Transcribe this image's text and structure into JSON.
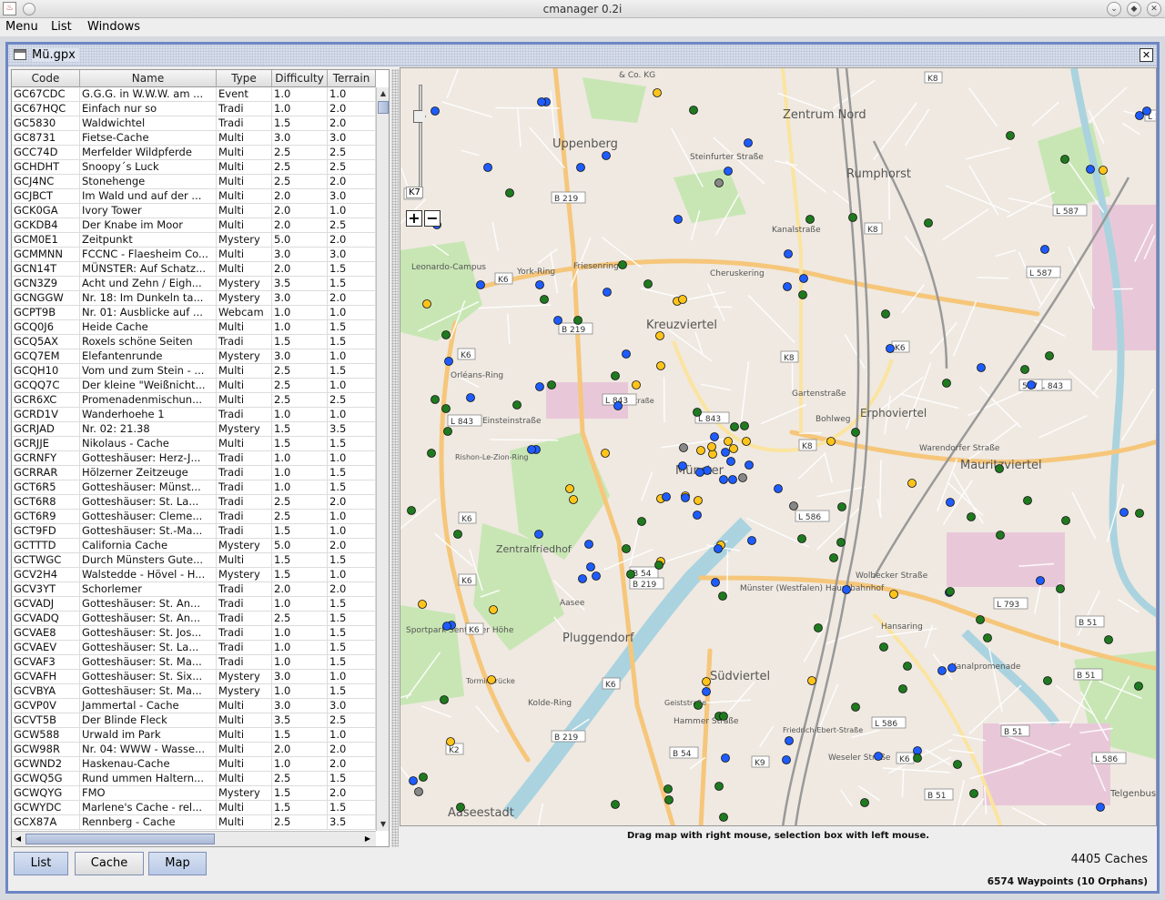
{
  "window": {
    "title": "cmanager 0.2i"
  },
  "menubar": {
    "items": [
      "Menu",
      "List",
      "Windows"
    ]
  },
  "frame": {
    "title": "Mü.gpx"
  },
  "table": {
    "columns": [
      "Code",
      "Name",
      "Type",
      "Difficulty",
      "Terrain"
    ],
    "rows": [
      [
        "GC67CDC",
        "G.G.G. in W.W.W. am ...",
        "Event",
        "1.0",
        "1.0"
      ],
      [
        "GC67HQC",
        "Einfach nur so",
        "Tradi",
        "1.0",
        "2.0"
      ],
      [
        "GC5830",
        "Waldwichtel",
        "Tradi",
        "1.5",
        "2.0"
      ],
      [
        "GC8731",
        "Fietse-Cache",
        "Multi",
        "3.0",
        "3.0"
      ],
      [
        "GCC74D",
        "Merfelder Wildpferde",
        "Multi",
        "2.5",
        "2.5"
      ],
      [
        "GCHDHT",
        "Snoopy´s Luck",
        "Multi",
        "2.5",
        "2.5"
      ],
      [
        "GCJ4NC",
        "Stonehenge",
        "Multi",
        "2.5",
        "2.0"
      ],
      [
        "GCJBCT",
        "Im Wald und auf der ...",
        "Multi",
        "2.0",
        "3.0"
      ],
      [
        "GCK0GA",
        "Ivory Tower",
        "Multi",
        "2.0",
        "1.0"
      ],
      [
        "GCKDB4",
        "Der Knabe im Moor",
        "Multi",
        "2.0",
        "2.5"
      ],
      [
        "GCM0E1",
        "Zeitpunkt",
        "Mystery",
        "5.0",
        "2.0"
      ],
      [
        "GCMMNN",
        "FCCNC - Flaesheim Co...",
        "Multi",
        "3.0",
        "3.0"
      ],
      [
        "GCN14T",
        "MÜNSTER: Auf Schatz...",
        "Multi",
        "2.0",
        "1.5"
      ],
      [
        "GCN3Z9",
        "Acht und Zehn / Eigh...",
        "Mystery",
        "3.5",
        "1.5"
      ],
      [
        "GCNGGW",
        "Nr. 18: Im Dunkeln ta...",
        "Mystery",
        "3.0",
        "2.0"
      ],
      [
        "GCPT9B",
        "Nr. 01: Ausblicke auf ...",
        "Webcam",
        "1.0",
        "1.0"
      ],
      [
        "GCQ0J6",
        "Heide Cache",
        "Multi",
        "1.0",
        "1.5"
      ],
      [
        "GCQ5AX",
        "Roxels schöne Seiten",
        "Tradi",
        "1.5",
        "1.5"
      ],
      [
        "GCQ7EM",
        "Elefantenrunde",
        "Mystery",
        "3.0",
        "1.0"
      ],
      [
        "GCQH10",
        "Vom und zum Stein - ...",
        "Multi",
        "2.5",
        "1.5"
      ],
      [
        "GCQQ7C",
        "Der kleine \"Weißnicht...",
        "Multi",
        "2.5",
        "1.0"
      ],
      [
        "GCR6XC",
        "Promenadenmischun...",
        "Multi",
        "2.5",
        "2.5"
      ],
      [
        "GCRD1V",
        "Wanderhoehe 1",
        "Tradi",
        "1.0",
        "1.0"
      ],
      [
        "GCRJAD",
        "Nr. 02: 21.38",
        "Mystery",
        "1.5",
        "3.5"
      ],
      [
        "GCRJJE",
        "Nikolaus - Cache",
        "Multi",
        "1.5",
        "1.5"
      ],
      [
        "GCRNFY",
        "Gotteshäuser: Herz-J...",
        "Tradi",
        "1.0",
        "1.0"
      ],
      [
        "GCRRAR",
        "Hölzerner Zeitzeuge",
        "Tradi",
        "1.0",
        "1.5"
      ],
      [
        "GCT6R5",
        "Gotteshäuser: Münst...",
        "Tradi",
        "1.0",
        "1.5"
      ],
      [
        "GCT6R8",
        "Gotteshäuser: St. La...",
        "Tradi",
        "2.5",
        "2.0"
      ],
      [
        "GCT6R9",
        "Gotteshäuser: Cleme...",
        "Tradi",
        "2.5",
        "1.0"
      ],
      [
        "GCT9FD",
        "Gotteshäuser: St.-Ma...",
        "Tradi",
        "1.5",
        "1.0"
      ],
      [
        "GCTTTD",
        "California Cache",
        "Mystery",
        "5.0",
        "2.0"
      ],
      [
        "GCTWGC",
        "Durch Münsters Gute...",
        "Multi",
        "1.5",
        "1.5"
      ],
      [
        "GCV2H4",
        "Walstedde - Hövel - H...",
        "Mystery",
        "1.5",
        "1.0"
      ],
      [
        "GCV3YT",
        "Schorlemer",
        "Tradi",
        "2.0",
        "2.0"
      ],
      [
        "GCVADJ",
        "Gotteshäuser: St. An...",
        "Tradi",
        "1.0",
        "1.5"
      ],
      [
        "GCVADQ",
        "Gotteshäuser: St. An...",
        "Tradi",
        "2.5",
        "1.5"
      ],
      [
        "GCVAE8",
        "Gotteshäuser: St. Jos...",
        "Tradi",
        "1.0",
        "1.5"
      ],
      [
        "GCVAEV",
        "Gotteshäuser: St. La...",
        "Tradi",
        "1.0",
        "1.5"
      ],
      [
        "GCVAF3",
        "Gotteshäuser: St. Ma...",
        "Tradi",
        "1.0",
        "1.5"
      ],
      [
        "GCVAFH",
        "Gotteshäuser: St. Six...",
        "Mystery",
        "3.0",
        "1.0"
      ],
      [
        "GCVBYA",
        "Gotteshäuser: St. Ma...",
        "Mystery",
        "1.0",
        "1.5"
      ],
      [
        "GCVP0V",
        "Jammertal - Cache",
        "Multi",
        "3.0",
        "3.0"
      ],
      [
        "GCVT5B",
        "Der Blinde Fleck",
        "Multi",
        "3.5",
        "2.5"
      ],
      [
        "GCW588",
        "Urwald im Park",
        "Multi",
        "1.5",
        "1.0"
      ],
      [
        "GCW98R",
        "Nr. 04: WWW - Wasse...",
        "Multi",
        "2.0",
        "2.0"
      ],
      [
        "GCWND2",
        "Haskenau-Cache",
        "Multi",
        "1.0",
        "2.0"
      ],
      [
        "GCWQ5G",
        "Rund ummen Haltern...",
        "Multi",
        "2.5",
        "1.5"
      ],
      [
        "GCWQYG",
        "FMO",
        "Mystery",
        "1.5",
        "2.0"
      ],
      [
        "GCWYDC",
        "Marlene's Cache - rel...",
        "Multi",
        "1.5",
        "1.5"
      ],
      [
        "GCX87A",
        "Rennberg - Cache",
        "Multi",
        "2.5",
        "3.5"
      ]
    ]
  },
  "map": {
    "hint": "Drag map with right mouse, selection box with left mouse.",
    "zoom_label": "K7",
    "zoom_in": "+",
    "zoom_out": "−",
    "labels": [
      "Zentrum Nord",
      "Uppenberg",
      "Rumphorst",
      "Kreuzviertel",
      "Erphoviertel",
      "Mauritzviertel",
      "Zentralfriedhof",
      "Pluggendorf",
      "Südviertel",
      "Aaseestadt",
      "Münster",
      "Münster (Westfalen) Hauptbahnhof",
      "Leonardo-Campus",
      "York-Ring",
      "Friesenring",
      "Cheruskering",
      "Telgenbusch",
      "Sportpark Sentruper Höhe",
      "Torminbrücke",
      "Kolde-Ring",
      "Orléans-Ring",
      "Einsteinstraße",
      "Münzstraße",
      "Bohlweg",
      "Warendorfer Straße",
      "Wolbecker Straße",
      "Hansaring",
      "Kanalpromenade",
      "Hammer Straße",
      "Geiststraße",
      "Weseler Straße",
      "Friedrich-Ebert-Straße",
      "Kanalstraße",
      "Gartenstraße",
      "Steinfurter Straße",
      "Rishon-Le-Zion-Ring",
      "Aasee",
      "& Co. KG"
    ],
    "road_badges": [
      "K8",
      "L 587",
      "L 587",
      "K8",
      "L 587",
      "B 219",
      "K6",
      "B 219",
      "K6",
      "K8",
      "L 843",
      "L 843",
      "K6",
      "L 843",
      "K6",
      "K6",
      "L 586",
      "K6",
      "B 54",
      "B 219",
      "K6",
      "L 793",
      "B 51",
      "B 51",
      "L 586",
      "K6",
      "L 586",
      "B 219",
      "B 54",
      "K9",
      "K2",
      "B 51",
      "B 51",
      "K8",
      "L 843",
      "587",
      "K7"
    ],
    "legend_colors": {
      "tradi": "#1f7a1f",
      "multi": "#ffc41a",
      "mystery": "#1e5cff",
      "other": "#888888"
    }
  },
  "bottom": {
    "tabs": [
      {
        "label": "List",
        "selected": true
      },
      {
        "label": "Cache",
        "selected": false
      },
      {
        "label": "Map",
        "selected": true
      }
    ],
    "cache_count": "4405 Caches",
    "waypoint_count": "6574 Waypoints (10 Orphans)"
  }
}
